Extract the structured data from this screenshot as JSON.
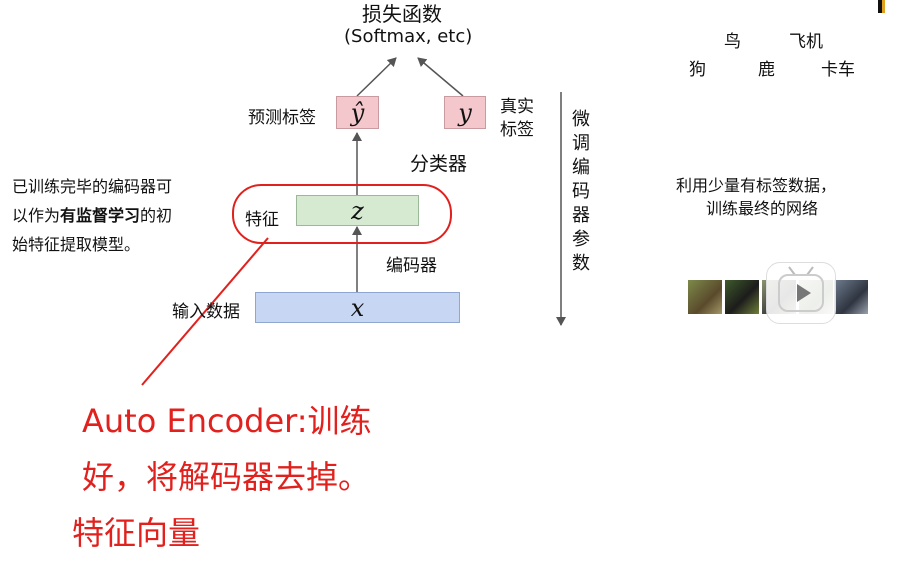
{
  "loss": {
    "title": "损失函数",
    "subtitle": "(Softmax, etc)"
  },
  "predicted_label": {
    "label": "预测标签",
    "symbol": "ŷ"
  },
  "true_label": {
    "symbol": "y",
    "label_line1": "真实",
    "label_line2": "标签"
  },
  "classifier_label": "分类器",
  "feature": {
    "label": "特征",
    "symbol": "z"
  },
  "encoder_label": "编码器",
  "input": {
    "label": "输入数据",
    "symbol": "x"
  },
  "finetune_label": [
    "微",
    "调",
    "编",
    "码",
    "器",
    "参",
    "数"
  ],
  "left_note": {
    "line1": "已训练完毕的编码器可",
    "line2_pre": "以作为",
    "line2_bold": "有监督学习",
    "line2_post": "的初",
    "line3": "始特征提取模型。"
  },
  "categories": {
    "row1": [
      "鸟",
      "飞机"
    ],
    "row2": [
      "狗",
      "鹿",
      "卡车"
    ]
  },
  "right_note": {
    "line1": "利用少量有标签数据，",
    "line2": "训练最终的网络"
  },
  "handwritten": {
    "line1": "Auto Encoder:训练",
    "line2": "好，将解码器去掉。",
    "line3": "特征向量"
  },
  "colors": {
    "pred_box": "#f4c7cc",
    "feature_box": "#d6ead2",
    "input_box": "#c6d6f3",
    "annotation_red": "#e0211d"
  },
  "icons": [
    "play-icon"
  ]
}
